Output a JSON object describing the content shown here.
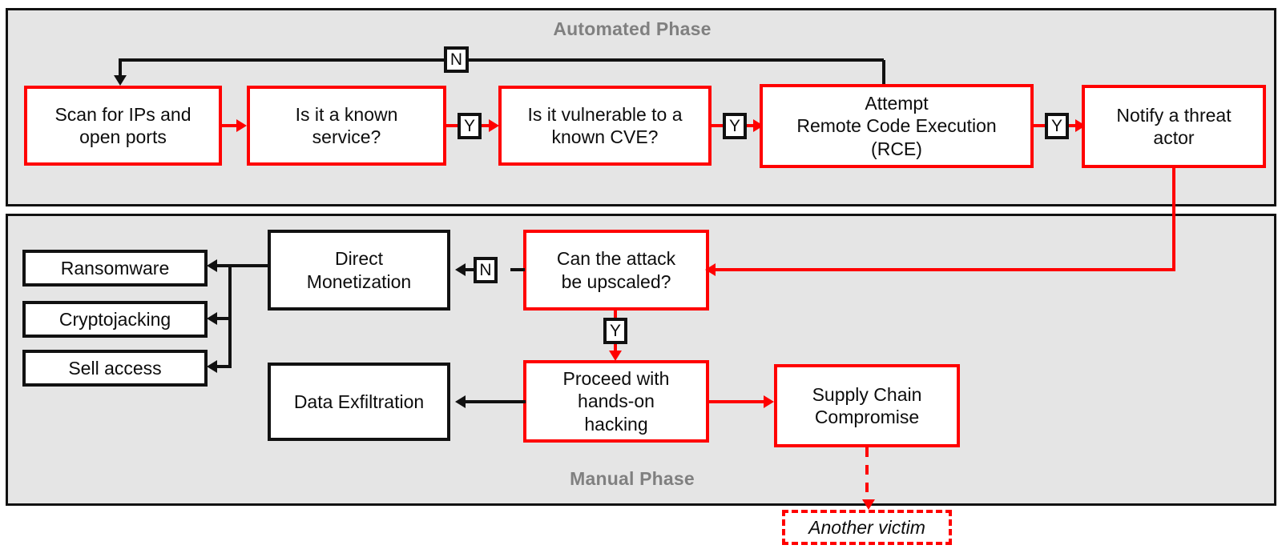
{
  "diagram": {
    "title_implied": "Attack lifecycle flowchart",
    "colors": {
      "accent_red": "#ff0000",
      "line_black": "#111111",
      "phase_fill": "#e5e5e5",
      "phase_label": "#808080",
      "node_fill": "#ffffff"
    }
  },
  "phases": {
    "automated": {
      "label": "Automated Phase"
    },
    "manual": {
      "label": "Manual Phase"
    }
  },
  "nodes": {
    "scan": "Scan for IPs and open ports",
    "known_service": "Is it a known service?",
    "known_cve": "Is it vulnerable to a known CVE?",
    "rce": "Attempt Remote Code Execution (RCE)",
    "notify": "Notify a threat actor",
    "upscaled": "Can the attack be upscaled?",
    "direct_monetization": "Direct Monetization",
    "ransomware": "Ransomware",
    "cryptojacking": "Cryptojacking",
    "sell_access": "Sell access",
    "proceed_hacking": "Proceed with hands-on hacking",
    "data_exfiltration": "Data Exfiltration",
    "supply_chain": "Supply Chain Compromise",
    "another_victim": "Another victim"
  },
  "node_lines": {
    "scan": [
      "Scan for IPs and",
      "open ports"
    ],
    "known_service": [
      "Is it a known",
      "service?"
    ],
    "known_cve": [
      "Is it vulnerable to a",
      "known CVE?"
    ],
    "rce": [
      "Attempt",
      "Remote Code Execution",
      "(RCE)"
    ],
    "notify": [
      "Notify a threat",
      "actor"
    ],
    "upscaled": [
      "Can the attack",
      "be upscaled?"
    ],
    "direct_monetization": [
      "Direct",
      "Monetization"
    ],
    "ransomware": [
      "Ransomware"
    ],
    "cryptojacking": [
      "Cryptojacking"
    ],
    "sell_access": [
      "Sell access"
    ],
    "proceed_hacking": [
      "Proceed with",
      "hands-on",
      "hacking"
    ],
    "data_exfiltration": [
      "Data Exfiltration"
    ],
    "supply_chain": [
      "Supply Chain",
      "Compromise"
    ],
    "another_victim": [
      "Another victim"
    ]
  },
  "edge_labels": {
    "no_cve_loop": "N",
    "yes_service": "Y",
    "yes_cve": "Y",
    "yes_rce": "Y",
    "no_upscale": "N",
    "yes_upscale": "Y"
  }
}
